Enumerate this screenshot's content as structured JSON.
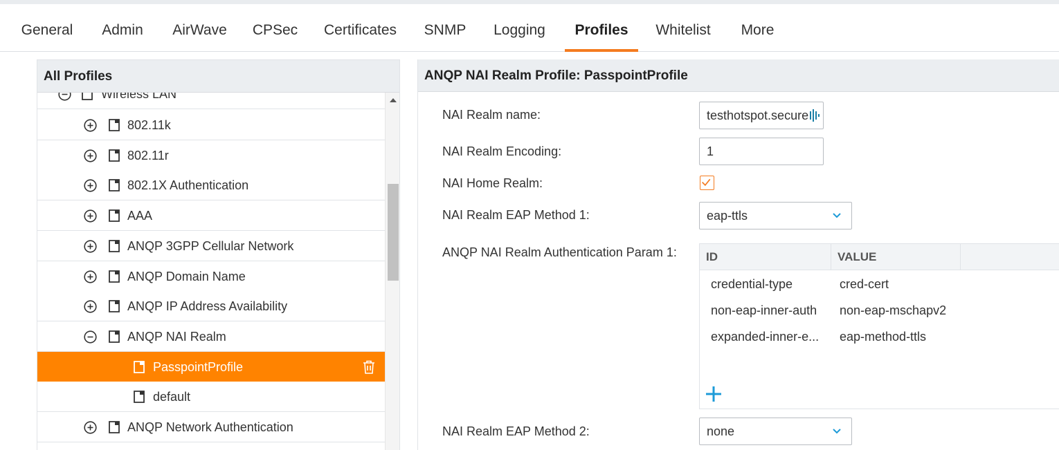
{
  "tabs": [
    "General",
    "Admin",
    "AirWave",
    "CPSec",
    "Certificates",
    "SNMP",
    "Logging",
    "Profiles",
    "Whitelist",
    "More"
  ],
  "active_tab": "Profiles",
  "left_panel": {
    "title": "All Profiles",
    "tree": [
      {
        "label": "Wireless LAN",
        "toggle": "collapse"
      },
      {
        "label": "802.11k",
        "toggle": "expand"
      },
      {
        "label": "802.11r",
        "toggle": "expand"
      },
      {
        "label": "802.1X Authentication",
        "toggle": "expand"
      },
      {
        "label": "AAA",
        "toggle": "expand"
      },
      {
        "label": "ANQP 3GPP Cellular Network",
        "toggle": "expand"
      },
      {
        "label": "ANQP Domain Name",
        "toggle": "expand"
      },
      {
        "label": "ANQP IP Address Availability",
        "toggle": "expand"
      },
      {
        "label": "ANQP NAI Realm",
        "toggle": "collapse"
      },
      {
        "label": "PasspointProfile",
        "selected": true
      },
      {
        "label": "default"
      },
      {
        "label": "ANQP Network Authentication",
        "toggle": "expand"
      }
    ]
  },
  "right_panel": {
    "title": "ANQP NAI Realm Profile: PasspointProfile",
    "fields": {
      "realm_name_label": "NAI Realm name:",
      "realm_name_value": "testhotspot.secure",
      "encoding_label": "NAI Realm Encoding:",
      "encoding_value": "1",
      "home_realm_label": "NAI Home Realm:",
      "home_realm_checked": true,
      "eap1_label": "NAI Realm EAP Method 1:",
      "eap1_value": "eap-ttls",
      "auth_param_label": "ANQP NAI Realm Authentication Param 1:",
      "eap2_label": "NAI Realm EAP Method 2:",
      "eap2_value": "none"
    },
    "auth_table": {
      "columns": [
        "ID",
        "VALUE"
      ],
      "rows": [
        [
          "credential-type",
          "cred-cert"
        ],
        [
          "non-eap-inner-auth",
          "non-eap-mschapv2"
        ],
        [
          "expanded-inner-e...",
          "eap-method-ttls"
        ]
      ]
    }
  },
  "colors": {
    "accent": "#f47b20",
    "selected_row": "#ff8300",
    "add_icon": "#1d9bd8",
    "header_bg": "#ebeef1"
  },
  "icons": {
    "expand": "plus-circle-icon",
    "collapse": "minus-circle-icon",
    "profile": "profile-doc-icon",
    "delete": "trash-icon",
    "dropdown": "chevron-down-icon",
    "add": "plus-icon"
  }
}
